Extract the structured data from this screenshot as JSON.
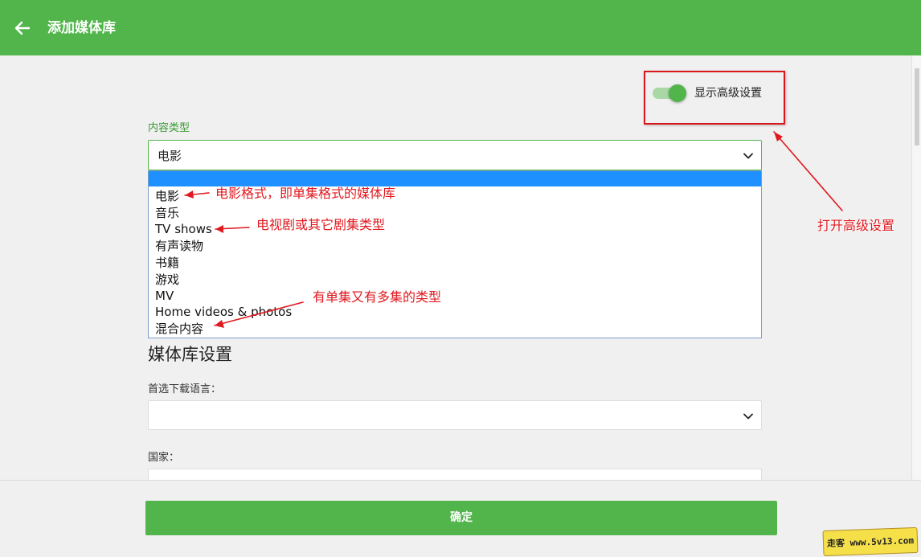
{
  "header": {
    "title": "添加媒体库",
    "back_icon": "arrow-left-icon"
  },
  "advanced_toggle": {
    "label": "显示高级设置",
    "enabled": true
  },
  "content_type": {
    "label": "内容类型",
    "selected": "电影",
    "options": [
      "电影",
      "音乐",
      "TV shows",
      "有声读物",
      "书籍",
      "游戏",
      "MV",
      "Home videos & photos",
      "混合内容"
    ]
  },
  "library_settings": {
    "title": "媒体库设置",
    "preferred_language_label": "首选下载语言：",
    "preferred_language_value": "",
    "country_label": "国家：",
    "country_value": ""
  },
  "footer": {
    "confirm_label": "确定"
  },
  "annotations": {
    "movie": "电影格式，即单集格式的媒体库",
    "tv": "电视剧或其它剧集类型",
    "mixed": "有单集又有多集的类型",
    "advanced": "打开高级设置"
  },
  "watermark": "走客 www.5v13.com",
  "colors": {
    "primary": "#52b54b",
    "annotation": "#e0191f",
    "highlight": "#1e90ff"
  }
}
